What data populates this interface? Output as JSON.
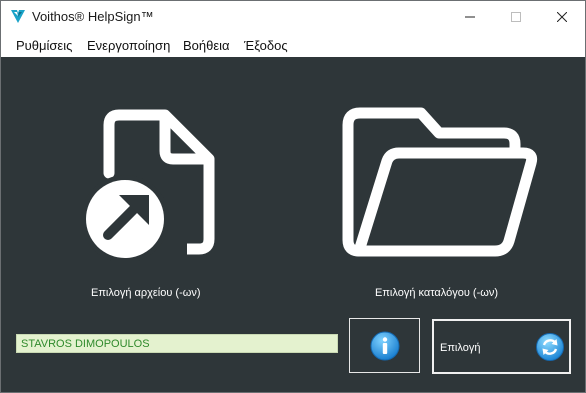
{
  "window": {
    "title": "Voithos® HelpSign™",
    "accent_color": "#2e3639"
  },
  "menu": {
    "items": [
      "Ρυθμίσεις",
      "Ενεργοποίηση",
      "Βοήθεια",
      "Έξοδος"
    ]
  },
  "main": {
    "file_caption": "Επιλογή αρχείου (-ων)",
    "folder_caption": "Επιλογή καταλόγου (-ων)",
    "name_field_value": "STAVROS DIMOPOULOS",
    "select_button_label": "Επιλογή"
  },
  "icons": {
    "app": "voithos-logo-icon",
    "file": "file-open-icon",
    "folder": "folder-icon",
    "info": "info-icon",
    "refresh": "refresh-icon"
  }
}
